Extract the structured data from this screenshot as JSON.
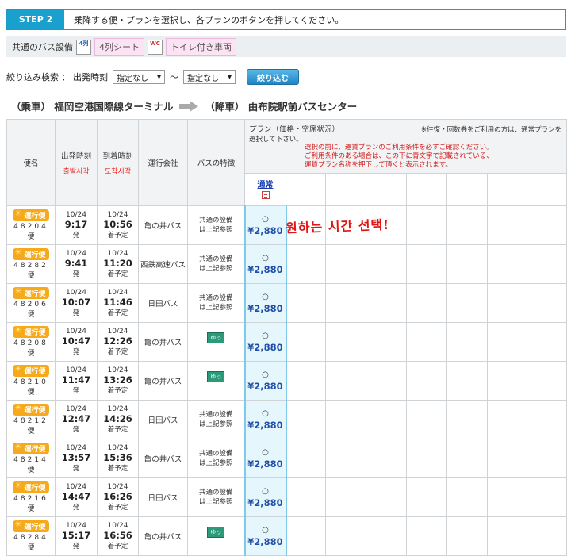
{
  "step": {
    "badge": "STEP 2",
    "text": "乗降する便・プランを選択し、各プランのボタンを押してください。"
  },
  "equipment": {
    "label": "共通のバス設備",
    "icon1_text": "4列",
    "chip1": "4列シート",
    "icon2_text": "WC",
    "chip2": "トイレ付き車両"
  },
  "filter": {
    "label": "絞り込み検索 ： 出発時刻",
    "from": "指定なし",
    "tilde": "〜",
    "to": "指定なし",
    "button": "絞り込む"
  },
  "route": {
    "board": "（乗車） 福岡空港国際線ターミナル",
    "alight": "（降車） 由布院駅前バスセンター"
  },
  "table": {
    "headers": {
      "bin": "便名",
      "depart": "出発時刻",
      "depart_note": "출발시각",
      "arrive": "到着時刻",
      "arrive_note": "도착시각",
      "operator": "運行会社",
      "feature": "バスの特徴",
      "plan_title": "プラン（価格・空席状況）",
      "plan_note": "※往復・回数券をご利用の方は、通常プランを選択して下さい。",
      "plan_red1": "選択の前に、運賃プランのご利用条件を必ずご確認ください。",
      "plan_red2": "ご利用条件のある場合は、この下に青文字で記載されている、",
      "plan_red3": "運賃プラン名称を押下して頂くと表示されます。",
      "plan_link": "通常"
    },
    "badge": "運行便",
    "unit_bin": "便",
    "unit_dep": "発",
    "unit_arr": "着予定",
    "rows": [
      {
        "no": "48204",
        "date_d": "10/24",
        "dep": "9:17",
        "date_a": "10/24",
        "arr": "10:56",
        "op": "亀の井バス",
        "feat1": "共通の設備",
        "feat2": "は上記参照",
        "yuttari": "",
        "avail": "○",
        "price": "¥2,880"
      },
      {
        "no": "48282",
        "date_d": "10/24",
        "dep": "9:41",
        "date_a": "10/24",
        "arr": "11:20",
        "op": "西鉄高速バス",
        "feat1": "共通の設備",
        "feat2": "は上記参照",
        "yuttari": "",
        "avail": "○",
        "price": "¥2,880"
      },
      {
        "no": "48206",
        "date_d": "10/24",
        "dep": "10:07",
        "date_a": "10/24",
        "arr": "11:46",
        "op": "日田バス",
        "feat1": "共通の設備",
        "feat2": "は上記参照",
        "yuttari": "",
        "avail": "○",
        "price": "¥2,880"
      },
      {
        "no": "48208",
        "date_d": "10/24",
        "dep": "10:47",
        "date_a": "10/24",
        "arr": "12:26",
        "op": "亀の井バス",
        "feat1": "",
        "feat2": "",
        "yuttari": "ゆったり",
        "avail": "○",
        "price": "¥2,880"
      },
      {
        "no": "48210",
        "date_d": "10/24",
        "dep": "11:47",
        "date_a": "10/24",
        "arr": "13:26",
        "op": "亀の井バス",
        "feat1": "",
        "feat2": "",
        "yuttari": "ゆったり",
        "avail": "○",
        "price": "¥2,880"
      },
      {
        "no": "48212",
        "date_d": "10/24",
        "dep": "12:47",
        "date_a": "10/24",
        "arr": "14:26",
        "op": "日田バス",
        "feat1": "共通の設備",
        "feat2": "は上記参照",
        "yuttari": "",
        "avail": "○",
        "price": "¥2,880"
      },
      {
        "no": "48214",
        "date_d": "10/24",
        "dep": "13:57",
        "date_a": "10/24",
        "arr": "15:36",
        "op": "亀の井バス",
        "feat1": "共通の設備",
        "feat2": "は上記参照",
        "yuttari": "",
        "avail": "○",
        "price": "¥2,880"
      },
      {
        "no": "48216",
        "date_d": "10/24",
        "dep": "14:47",
        "date_a": "10/24",
        "arr": "16:26",
        "op": "日田バス",
        "feat1": "共通の設備",
        "feat2": "は上記参照",
        "yuttari": "",
        "avail": "○",
        "price": "¥2,880"
      },
      {
        "no": "48284",
        "date_d": "10/24",
        "dep": "15:17",
        "date_a": "10/24",
        "arr": "16:56",
        "op": "亀の井バス",
        "feat1": "",
        "feat2": "",
        "yuttari": "ゆったり",
        "avail": "○",
        "price": "¥2,880"
      }
    ]
  },
  "annotation": "원하는 시간 선택!",
  "colors": {
    "accent": "#1aa0cd",
    "price": "#1e4fa8",
    "annotation": "#e11515",
    "badge": "#f7a91c"
  }
}
